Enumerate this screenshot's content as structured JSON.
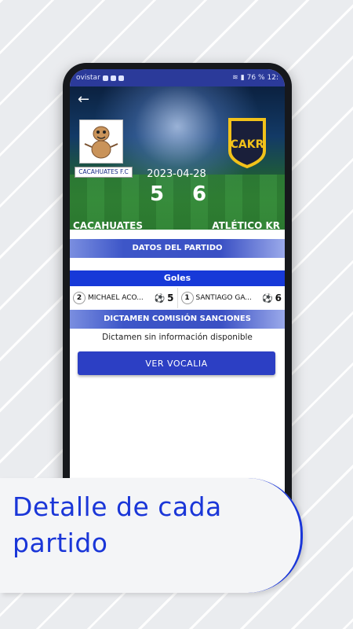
{
  "status_bar": {
    "carrier": "ovistar",
    "battery": "76 %",
    "time": "12:"
  },
  "match": {
    "date": "2023-04-28",
    "home": {
      "logo_caption": "CACAHUATES F.C",
      "name": "CACAHUATES",
      "score": "5"
    },
    "away": {
      "logo_text": "CAKR",
      "name": "ATLÉTICO KR",
      "score": "6"
    }
  },
  "sections": {
    "datos": "DATOS DEL PARTIDO",
    "goles": "Goles",
    "dictamen": "DICTAMEN COMISIÓN SANCIONES",
    "dictamen_text": "Dictamen sin información disponible"
  },
  "goals": [
    {
      "number": "2",
      "player": "MICHAEL ACO...",
      "count": "5"
    },
    {
      "number": "1",
      "player": "SANTIAGO GA...",
      "count": "6"
    }
  ],
  "buttons": {
    "vocalia": "VER VOCALIA"
  },
  "caption": "Detalle de cada partido",
  "colors": {
    "accent": "#1a36d8",
    "header": "#2b3a9a",
    "button": "#2c3fc4"
  }
}
